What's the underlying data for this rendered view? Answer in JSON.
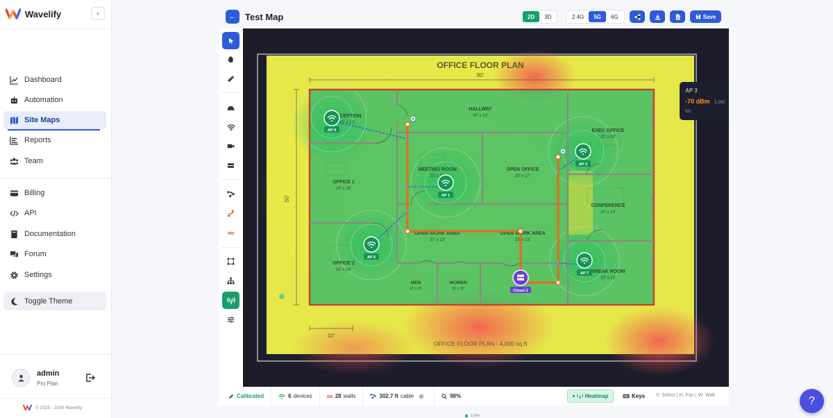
{
  "app": {
    "name": "Wavelify",
    "copyright": "© 2025 - 2026 Wavelify"
  },
  "sidebar": {
    "items": [
      {
        "label": "Dashboard",
        "icon": "chart-line-icon"
      },
      {
        "label": "Automation",
        "icon": "robot-icon"
      },
      {
        "label": "Site Maps",
        "icon": "map-icon",
        "active": true
      },
      {
        "label": "Reports",
        "icon": "bar-list-icon"
      },
      {
        "label": "Team",
        "icon": "users-icon"
      },
      {
        "label": "Billing",
        "icon": "credit-card-icon"
      },
      {
        "label": "API",
        "icon": "code-icon"
      },
      {
        "label": "Documentation",
        "icon": "book-icon"
      },
      {
        "label": "Forum",
        "icon": "comments-icon"
      },
      {
        "label": "Settings",
        "icon": "gear-icon"
      }
    ],
    "theme_label": "Toggle Theme",
    "user": {
      "name": "admin",
      "plan": "Pro Plan"
    }
  },
  "header": {
    "title": "Test Map",
    "view_modes": [
      "2D",
      "3D"
    ],
    "active_view": "2D",
    "bands": [
      "2.4G",
      "5G",
      "6G"
    ],
    "active_band": "5G",
    "save_label": "Save"
  },
  "floorplan": {
    "title": "OFFICE FLOOR PLAN",
    "footer": "OFFICE FLOOR PLAN - 4,000 sq ft",
    "width_label": "80'",
    "height_label": "50'",
    "scale_label": "10'",
    "rooms": [
      {
        "name": "RECEPTION",
        "dims": "15' x 12'"
      },
      {
        "name": "HALLWAY",
        "dims": "40' x 10'"
      },
      {
        "name": "EXEC OFFICE",
        "dims": "20' x 20'"
      },
      {
        "name": "MEETING ROOM",
        "dims": "20' x 17'"
      },
      {
        "name": "OPEN OFFICE",
        "dims": "20' x 17'"
      },
      {
        "name": "OFFICE 1",
        "dims": "20' x 19'"
      },
      {
        "name": "CONFERENCE",
        "dims": "20' x 15'"
      },
      {
        "name": "OPEN WORK AREA",
        "dims": "20' x 13'"
      },
      {
        "name": "OPEN WORK AREA",
        "dims": "20' x 13'"
      },
      {
        "name": "OFFICE 2",
        "dims": "20' x 19'"
      },
      {
        "name": "BREAK ROOM",
        "dims": "20' x 15'"
      },
      {
        "name": "MEN",
        "dims": "10' x 10'"
      },
      {
        "name": "WOMEN",
        "dims": "10' x 10'"
      }
    ],
    "access_points": [
      "AP 9",
      "AP 1",
      "AP 3",
      "AP 5",
      "AP 7"
    ],
    "closet": "Closet-1"
  },
  "tooltip": {
    "ap": "AP 3",
    "signal": "-70 dBm",
    "quality": "Low",
    "band": "5G"
  },
  "status": {
    "calibrated": "Calibrated",
    "devices_count": "6",
    "devices_label": "devices",
    "walls_count": "28",
    "walls_label": "walls",
    "cable_length": "302.7 ft",
    "cable_label": "cable",
    "zoom": "98%",
    "heatmap_label": "Heatmap",
    "keys_label": "Keys",
    "hint": "V: Select | H: Pan | W: Wall",
    "live": "Live"
  },
  "help_glyph": "?"
}
